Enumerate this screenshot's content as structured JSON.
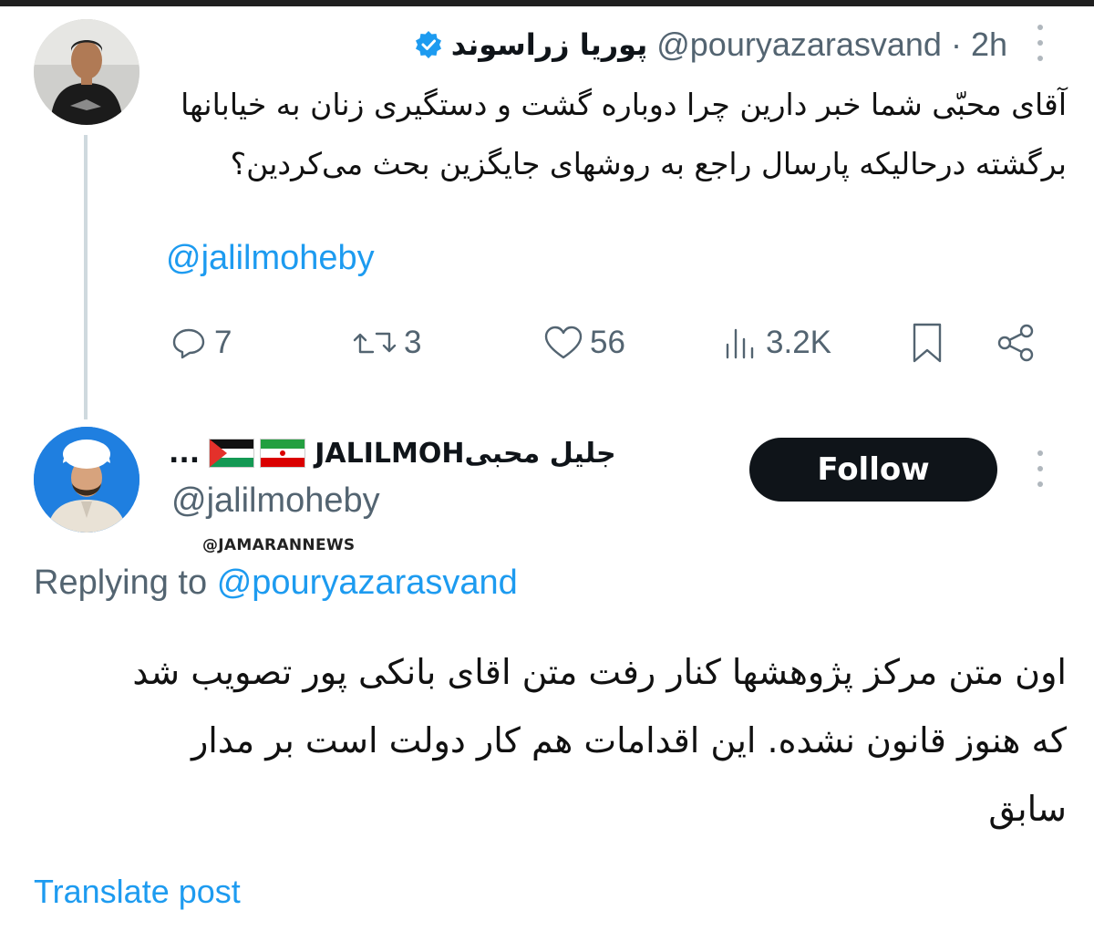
{
  "tweet": {
    "author_name": "پوریا زراسوند",
    "author_handle": "@pouryazarasvand",
    "separator": "·",
    "time": "2h",
    "text": "آقای محبّی شما خبر دارین چرا دوباره گشت و دستگیری زنان به خیابانها برگشته درحالیکه پارسال راجع به روشهای جایگزین بحث می‌کردین؟",
    "mention": "@jalilmoheby",
    "stats": {
      "replies": "7",
      "retweets": "3",
      "likes": "56",
      "views": "3.2K"
    }
  },
  "reply": {
    "author_name": "جلیل محبیJALILMOH",
    "author_ellipsis": "...",
    "author_handle": "@jalilmoheby",
    "watermark": "@JAMARANNEWS",
    "follow_label": "Follow",
    "replying_prefix": "Replying to",
    "replying_handle": "@pouryazarasvand",
    "text": "اون متن مرکز پژوهشها کنار رفت متن اقای بانکی پور تصویب شد که هنوز قانون نشده. این اقدامات هم کار دولت است بر مدار سابق",
    "translate_label": "Translate post"
  },
  "colors": {
    "link": "#1d9bf0",
    "muted": "#536471",
    "text": "#0f1419",
    "follow_bg": "#0f1419"
  },
  "icons": [
    "verified-badge-icon",
    "more-icon",
    "reply-icon",
    "retweet-icon",
    "like-icon",
    "views-icon",
    "bookmark-icon",
    "share-icon",
    "palestine-flag-icon",
    "iran-flag-icon"
  ]
}
